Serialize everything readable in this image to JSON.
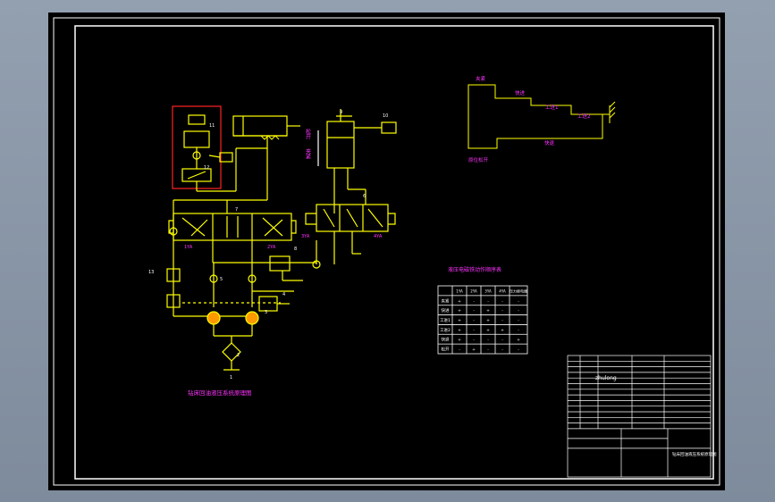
{
  "colors": {
    "background": "#000000",
    "frame": "#ffffff",
    "hydraulic_lines": "#ffff00",
    "labels": "#ff33ff",
    "numbers": "#ffffff",
    "highlight_box": "#ff0000",
    "viewer_bg": "#8796a8"
  },
  "circuit": {
    "title": "钻床回油液压系统原理图",
    "part_numbers": [
      "1",
      "2",
      "3",
      "4",
      "5",
      "6",
      "7",
      "8",
      "9",
      "10",
      "11",
      "12",
      "13"
    ],
    "solenoid_labels": [
      "1YA",
      "2YA",
      "3YA",
      "4YA"
    ],
    "cylinder_labels": {
      "release": "松开",
      "clamp": "夹紧"
    }
  },
  "cycle_diagram": {
    "labels": [
      "夹紧",
      "快进",
      "工进1",
      "工进2",
      "快退",
      "原位松开"
    ]
  },
  "sequence_table": {
    "title": "液压电磁铁动作顺序表",
    "headers": [
      "",
      "1YA",
      "2YA",
      "3YA",
      "4YA",
      "压力继电器"
    ],
    "rows": [
      [
        "夹紧",
        "+",
        "-",
        "-",
        "-",
        "-"
      ],
      [
        "快进",
        "+",
        "-",
        "+",
        "-",
        "-"
      ],
      [
        "工进1",
        "+",
        "-",
        "+",
        "-",
        "-"
      ],
      [
        "工进2",
        "+",
        "-",
        "+",
        "+",
        "-"
      ],
      [
        "快退",
        "+",
        "-",
        "-",
        "-",
        "+"
      ],
      [
        "松开",
        "-",
        "+",
        "-",
        "-",
        "-"
      ]
    ]
  },
  "title_block": {
    "watermark": "zhulong",
    "drawing_name": "钻床回油液压系统原理图",
    "rows_count": 13
  }
}
